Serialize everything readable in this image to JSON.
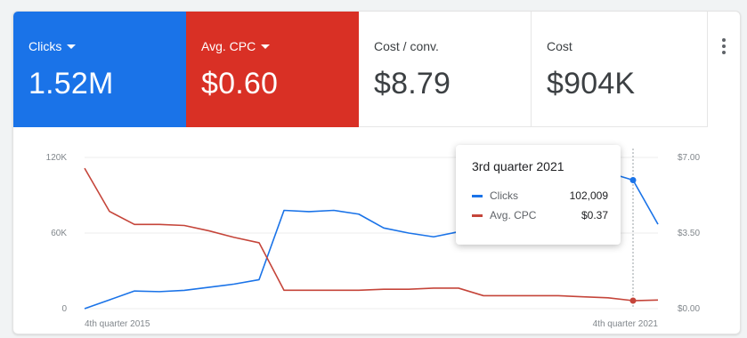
{
  "tiles": [
    {
      "label": "Clicks",
      "value": "1.52M",
      "has_dropdown": true,
      "bg": "#1a73e8"
    },
    {
      "label": "Avg. CPC",
      "value": "$0.60",
      "has_dropdown": true,
      "bg": "#d93025"
    },
    {
      "label": "Cost / conv.",
      "value": "$8.79",
      "has_dropdown": false
    },
    {
      "label": "Cost",
      "value": "$904K",
      "has_dropdown": false
    }
  ],
  "tooltip": {
    "title": "3rd quarter 2021",
    "rows": [
      {
        "name": "Clicks",
        "value": "102,009",
        "color": "#1a73e8"
      },
      {
        "name": "Avg. CPC",
        "value": "$0.37",
        "color": "#c5453a"
      }
    ]
  },
  "chart_data": {
    "type": "line",
    "x": [
      "4th quarter 2015",
      "",
      "",
      "",
      "",
      "",
      "",
      "",
      "",
      "",
      "",
      "",
      "",
      "",
      "",
      "",
      "",
      "",
      "",
      "",
      "",
      "",
      "",
      "4th quarter 2021"
    ],
    "x_tick_labels": [
      "4th quarter 2015",
      "4th quarter 2021"
    ],
    "y_left_ticks": [
      "0",
      "60K",
      "120K"
    ],
    "y_left_lim": [
      0,
      120000
    ],
    "y_right_ticks": [
      "$0.00",
      "$3.50",
      "$7.00"
    ],
    "y_right_lim": [
      0,
      7
    ],
    "grid": true,
    "hover_index": 22,
    "series": [
      {
        "name": "Clicks",
        "axis": "left",
        "color": "#1a73e8",
        "values": [
          0,
          7000,
          14000,
          13500,
          14500,
          17000,
          19500,
          23000,
          78000,
          77000,
          78000,
          75000,
          64000,
          60000,
          57000,
          61000,
          92000,
          107000,
          111000,
          109000,
          112000,
          108000,
          102009,
          67000
        ]
      },
      {
        "name": "Avg. CPC",
        "axis": "right",
        "color": "#c5453a",
        "values": [
          6.5,
          4.5,
          3.9,
          3.9,
          3.85,
          3.6,
          3.3,
          3.05,
          0.85,
          0.85,
          0.85,
          0.85,
          0.9,
          0.9,
          0.95,
          0.95,
          0.6,
          0.6,
          0.6,
          0.6,
          0.55,
          0.5,
          0.37,
          0.4
        ]
      }
    ]
  }
}
